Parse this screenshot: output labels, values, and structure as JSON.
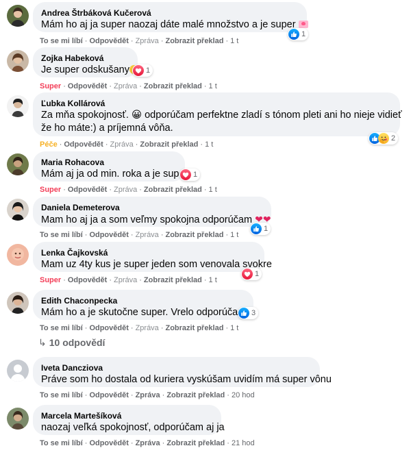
{
  "actions": {
    "like": "To se mi líbí",
    "reply": "Odpovědět",
    "message": "Zpráva",
    "translate": "Zobrazit překlad"
  },
  "colors": {
    "bubble": "#f0f2f5",
    "like_blue": "#1877f2",
    "heart_red": "#f33e58",
    "care_yellow": "#f7b125"
  },
  "comments": [
    {
      "author": "Andrea Štrbáková Kučerová",
      "text": "Mám ho aj ja super naozaj dáte malé množstvo a je super",
      "reaction_label": "To se mi líbí",
      "time": "1 t",
      "reaction_count": "1",
      "reaction_icons": [
        "like-icon"
      ]
    },
    {
      "author": "Zojka Habeková",
      "text": "Je super odskušany",
      "reaction_label": "Super",
      "time": "1 t",
      "reaction_count": "1",
      "reaction_icons": [
        "heart-icon"
      ]
    },
    {
      "author": "Ľubka Kollárová",
      "text_line1": "Za mňa spokojnosť. 😀 odporúčam perfektne zladí s tónom pleti ani ho nieje vidieť",
      "text_line2": "že ho máte:) a príjemná vôňa.",
      "reaction_label": "Péče",
      "time": "1 t",
      "reaction_count": "2",
      "reaction_icons": [
        "like-icon",
        "care-icon"
      ]
    },
    {
      "author": "Maria Rohacova",
      "text": "Mám aj ja od min. roka a je super",
      "reaction_label": "Super",
      "time": "1 t",
      "reaction_count": "1",
      "reaction_icons": [
        "heart-icon"
      ]
    },
    {
      "author": "Daniela Demeterova",
      "text": "Mam ho aj ja a som veľmy spokojna odporúčam",
      "reaction_label": "To se mi líbí",
      "time": "1 t",
      "reaction_count": "1",
      "reaction_icons": [
        "like-icon"
      ]
    },
    {
      "author": "Lenka Čajkovská",
      "text": "Mam uz 4ty kus je super jeden som venovala svokre",
      "reaction_label": "Super",
      "time": "1 t",
      "reaction_count": "1",
      "reaction_icons": [
        "heart-icon"
      ]
    },
    {
      "author": "Edith Chaconpecka",
      "text": "Mám ho a je skutočne super. Vrelo odporúčam.",
      "reaction_label": "To se mi líbí",
      "time": "1 t",
      "reaction_count": "3",
      "reaction_icons": [
        "like-icon"
      ]
    },
    {
      "author": "Iveta Dancziova",
      "text": "Práve som ho dostala od kuriera vyskúšam uvidím má super vônu",
      "reaction_label": "To se mi líbí",
      "time": "20 hod"
    },
    {
      "author": "Marcela Martešíková",
      "text": "naozaj veľká spokojnosť, odporúčam aj ja",
      "reaction_label": "To se mi líbí",
      "time": "21 hod"
    }
  ],
  "replies_link": {
    "arrow": "↳",
    "label": "10 odpovědí"
  }
}
